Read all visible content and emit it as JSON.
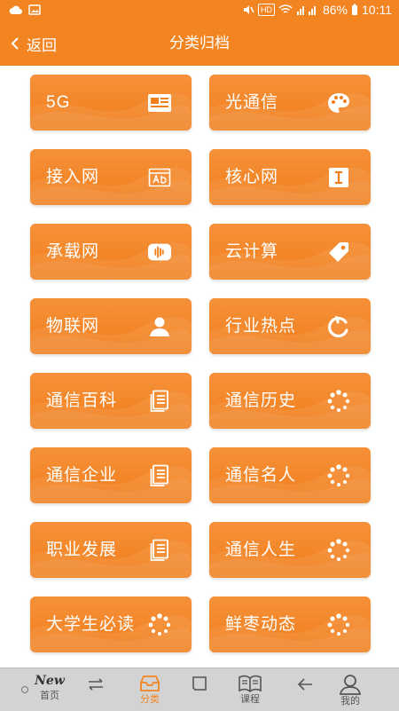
{
  "status": {
    "battery": "86%",
    "time": "10:11",
    "network_badge": "HD"
  },
  "header": {
    "back_label": "返回",
    "title": "分类归档"
  },
  "tiles": [
    {
      "label": "5G",
      "icon": "id-card-icon"
    },
    {
      "label": "光通信",
      "icon": "palette-icon"
    },
    {
      "label": "接入网",
      "icon": "ad-frame-icon"
    },
    {
      "label": "核心网",
      "icon": "text-cursor-icon"
    },
    {
      "label": "承载网",
      "icon": "audio-wave-icon"
    },
    {
      "label": "云计算",
      "icon": "tag-icon"
    },
    {
      "label": "物联网",
      "icon": "user-icon"
    },
    {
      "label": "行业热点",
      "icon": "refresh-icon"
    },
    {
      "label": "通信百科",
      "icon": "document-icon"
    },
    {
      "label": "通信历史",
      "icon": "spinner-icon"
    },
    {
      "label": "通信企业",
      "icon": "document-icon"
    },
    {
      "label": "通信名人",
      "icon": "spinner-icon"
    },
    {
      "label": "职业发展",
      "icon": "document-icon"
    },
    {
      "label": "通信人生",
      "icon": "spinner-icon"
    },
    {
      "label": "大学生必读",
      "icon": "spinner-icon"
    },
    {
      "label": "鲜枣动态",
      "icon": "spinner-icon"
    }
  ],
  "nav": {
    "new_badge": "New",
    "home": "首页",
    "category": "分类",
    "course": "课程",
    "mine": "我的"
  },
  "colors": {
    "accent": "#f28522",
    "tile": "#f07e1b",
    "nav_bg": "#d3d3d3"
  }
}
